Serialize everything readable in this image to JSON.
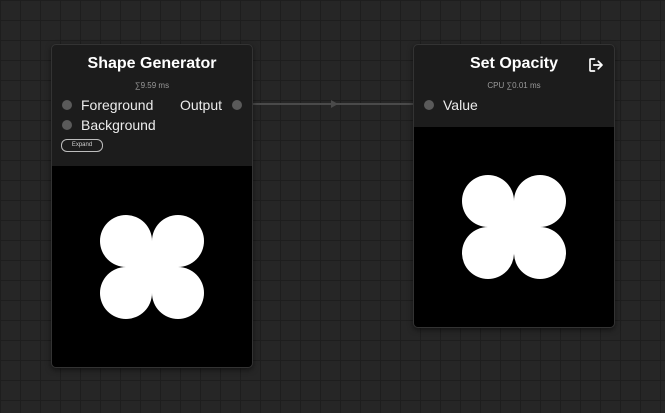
{
  "canvas": {
    "background": "#262626",
    "grid_color": "#1e1e1e",
    "wire_color": "#4a4a4a"
  },
  "nodes": {
    "shape_generator": {
      "title": "Shape Generator",
      "stats": "∑9.59 ms",
      "inputs": [
        "Foreground",
        "Background"
      ],
      "output": "Output",
      "expand_label": "Expand",
      "preview_shape": "x-shape"
    },
    "set_opacity": {
      "title": "Set Opacity",
      "stats": "CPU ∑0.01 ms",
      "inputs": [
        "Value"
      ],
      "header_icon": "exit-icon",
      "preview_shape": "x-shape"
    }
  }
}
